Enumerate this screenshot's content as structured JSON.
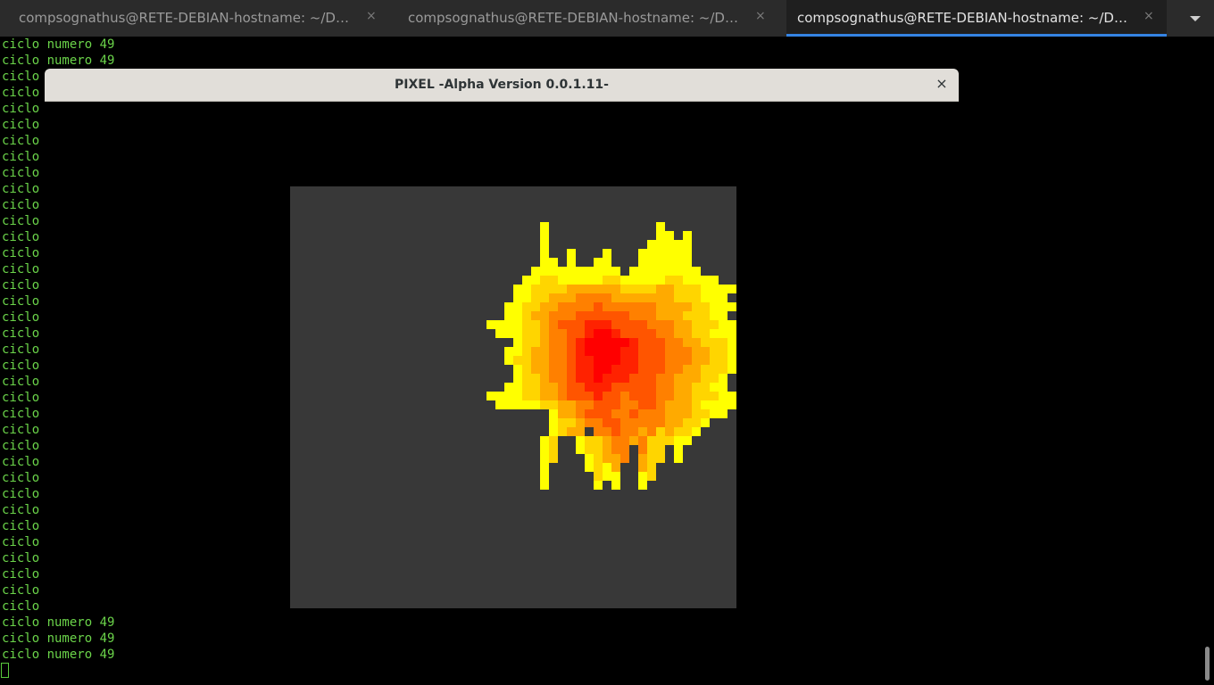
{
  "tabs": [
    {
      "title": "compsognathus@RETE-DEBIAN-hostname: ~/Docume…",
      "close": "×"
    },
    {
      "title": "compsognathus@RETE-DEBIAN-hostname: ~/Docume…",
      "close": "×"
    },
    {
      "title": "compsognathus@RETE-DEBIAN-hostname: ~/Docume…",
      "close": "×"
    }
  ],
  "active_tab": 2,
  "terminal": {
    "full_line": "ciclo numero 49",
    "short_line": "ciclo",
    "text_color": "#6bd44a"
  },
  "dialog": {
    "title": "PIXEL -Alpha Version 0.0.1.11-",
    "close": "×",
    "canvas_color": "#383838"
  },
  "sprite": {
    "description_icon": "fire-pixel-sprite",
    "palette": {
      "y": "#ffff00",
      "g": "#ffd500",
      "o": "#ffaa00",
      "d": "#ff8000",
      "n": "#ff5500",
      "r": "#ff2200",
      "R": "#ff0000"
    },
    "rows": [
      "..........................................",
      "...........y............y.................",
      "...........y............yy.y..............",
      "...........y...........yyyyy..............",
      "...........y..y...y...yyyyyy..............",
      "...........yy.y..yy...yyyyyy..............",
      "..........yyyyyyyyyy.yyyyyyyy.............",
      ".........yyggyyyyyggyyyyyggyyyy...........",
      "........yyggggooooooggggoogggyyyy.........",
      "........yyggoooddddooooooogggyyy..........",
      ".......yyggooddddnddddddooooggyyyy........",
      ".......yygoodddnnnnnndddooogggyy..........",
      ".....yyyyggodnnnrrrnnnndddoogggyy.........",
      "......yyyggoddnnrRRrnnnnddooggyyyyyy......",
      "........yggoddnrRRRRRrnnnddoogggyyyy......",
      ".......yygooddnrRRRRrrnnndddooggyy........",
      ".......yggooddnrrRRRrrnnndddooggy.........",
      "........ygooddnrrRRrrrnnnddoogggyyy.......",
      "........yggoddnrrRrrrnnnddoooggy..........",
      ".......yyggoodnnrrrnnnnnddooggyy..........",
      ".....yyyyggoodnnnrnndnnnddoogggyyyy.......",
      "......yyyyyggooddnnnddnndooogyyyyyy.......",
      "............yoodnnnddndddoooggyy..........",
      "............yggoddnndddddooggy............",
      "............ygoo.ddnddodgoggy.............",
      "...........yg..yggoddodgggyy..............",
      "...........yg..yggodd.dgg.y...............",
      "...........yg...ygood.ogg.y...............",
      "...........y....ygyo..og..................",
      "...........y.....gyy..yg..................",
      "...........y.....y.y..y...................",
      ".........................................."
    ]
  }
}
